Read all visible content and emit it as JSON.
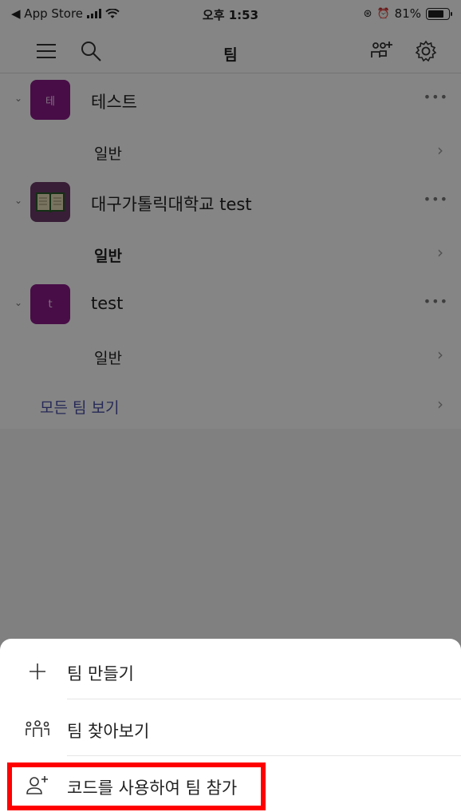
{
  "status_bar": {
    "back_app": "◀ App Store",
    "time": "오후 1:53",
    "battery": "81%",
    "battery_level": 0.81
  },
  "nav": {
    "title": "팀",
    "menu_icon": "hamburger-icon",
    "search_icon": "search-icon",
    "add_team_icon": "add-team-icon",
    "settings_icon": "gear-icon"
  },
  "teams": [
    {
      "name": "테스트",
      "avatar_text": "테",
      "avatar_color": "#8a1a88",
      "channel": "일반"
    },
    {
      "name": "대구가톨릭대학교 test",
      "avatar_text": "",
      "avatar_color": "#6b3a6a",
      "channel": "일반"
    },
    {
      "name": "test",
      "avatar_text": "t",
      "avatar_color": "#8a1a88",
      "channel": "일반"
    }
  ],
  "see_all": "모든 팀 보기",
  "sheet": {
    "items": [
      {
        "label": "팀 만들기",
        "icon": "plus-icon"
      },
      {
        "label": "팀 찾아보기",
        "icon": "teams-browse-icon"
      },
      {
        "label": "코드를 사용하여 팀 참가",
        "icon": "join-with-code-icon"
      }
    ]
  },
  "colors": {
    "accent": "#4b50a8",
    "highlight": "#ff0000",
    "team_avatar": "#8a1a88"
  }
}
